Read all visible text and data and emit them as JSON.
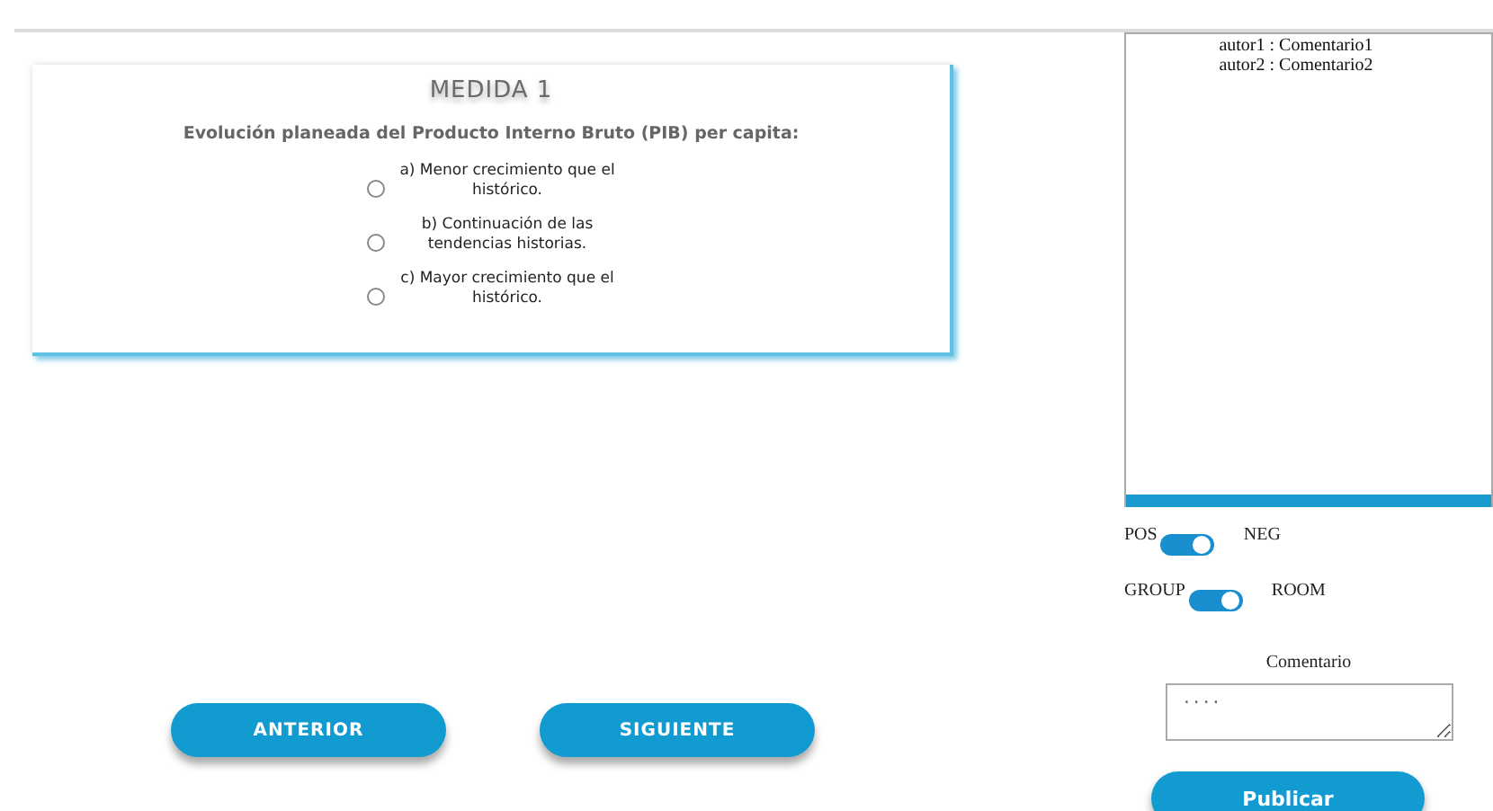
{
  "question": {
    "title": "MEDIDA 1",
    "prompt": "Evolución planeada del Producto Interno Bruto (PIB) per capita:",
    "options": [
      {
        "label": "a) Menor crecimiento que el histórico.",
        "selected": false
      },
      {
        "label": "b) Continuación de las tendencias historias.",
        "selected": false
      },
      {
        "label": "c) Mayor crecimiento que el histórico.",
        "selected": false
      }
    ]
  },
  "navigation": [
    "ANTERIOR",
    "SIGUIENTE"
  ],
  "comments": {
    "entries": [
      "autor1 : Comentario1",
      "autor2 : Comentario2"
    ],
    "toggles": [
      {
        "left": "POS",
        "right": "NEG",
        "on": true
      },
      {
        "left": "GROUP",
        "right": "ROOM",
        "on": true
      }
    ],
    "label": "Comentario",
    "placeholder": "....",
    "button": "Publicar"
  }
}
